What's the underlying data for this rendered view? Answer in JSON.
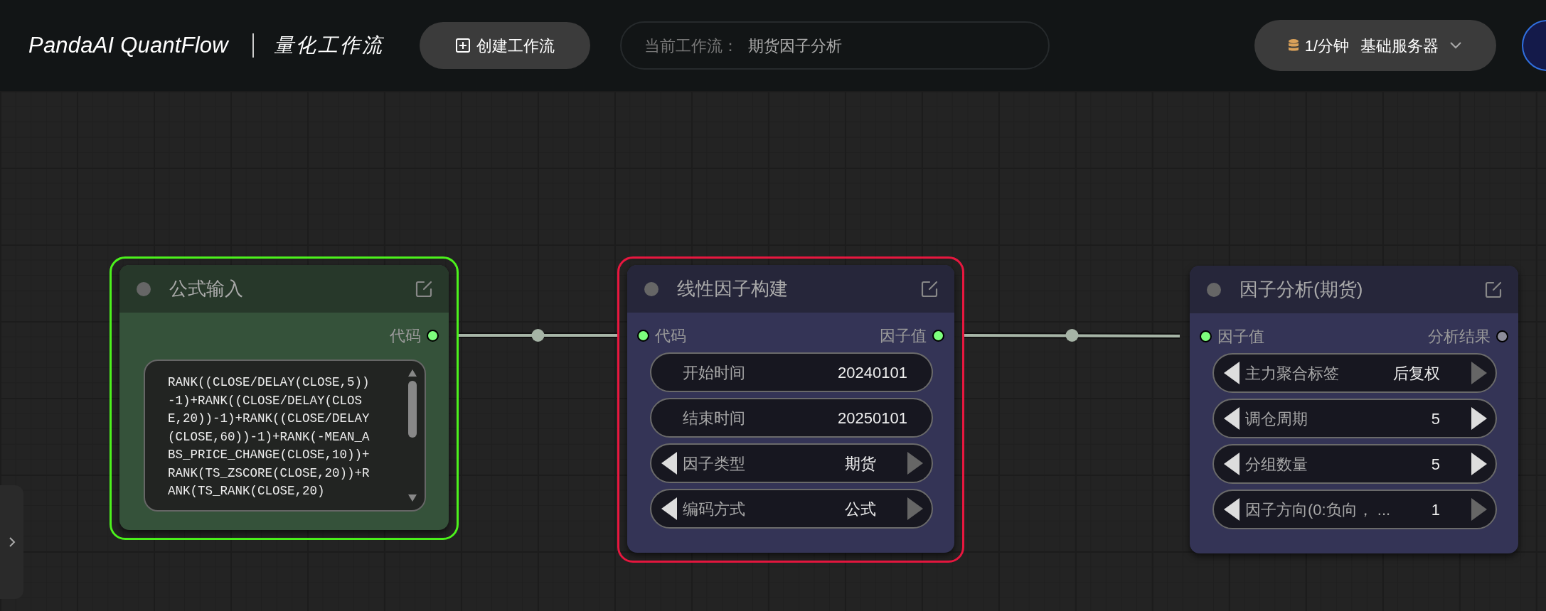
{
  "header": {
    "logo": "PandaAI QuantFlow",
    "title": "量化工作流",
    "create_button": "创建工作流",
    "current_workflow": {
      "label": "当前工作流：",
      "value": "期货因子分析"
    },
    "server": {
      "rate": "1/分钟",
      "name": "基础服务器"
    }
  },
  "nodes": [
    {
      "title": "公式输入",
      "color": "#35523a",
      "selected": true,
      "error": false,
      "outputs": [
        {
          "label": "代码",
          "connected": true
        }
      ],
      "widgets": [
        {
          "kind": "code",
          "value": "RANK((CLOSE/DELAY(CLOSE,5))-1)+RANK((CLOSE/DELAY(CLOSE,20))-1)+RANK((CLOSE/DELAY(CLOSE,60))-1)+RANK(-MEAN_ABS_PRICE_CHANGE(CLOSE,10))+RANK(TS_ZSCORE(CLOSE,20))+RANK(TS_RANK(CLOSE,20)"
        }
      ]
    },
    {
      "title": "线性因子构建",
      "color": "#343456",
      "selected": false,
      "error": true,
      "inputs": [
        {
          "label": "代码",
          "connected": true
        }
      ],
      "outputs": [
        {
          "label": "因子值",
          "connected": true
        }
      ],
      "widgets": [
        {
          "kind": "text",
          "label": "开始时间",
          "value": "20240101"
        },
        {
          "kind": "text",
          "label": "结束时间",
          "value": "20250101"
        },
        {
          "kind": "combo",
          "label": "因子类型",
          "value": "期货",
          "prev_enabled": true,
          "next_enabled": false
        },
        {
          "kind": "combo",
          "label": "编码方式",
          "value": "公式",
          "prev_enabled": true,
          "next_enabled": false
        }
      ]
    },
    {
      "title": "因子分析(期货)",
      "color": "#343456",
      "selected": false,
      "error": false,
      "inputs": [
        {
          "label": "因子值",
          "connected": true
        }
      ],
      "outputs": [
        {
          "label": "分析结果",
          "connected": false
        }
      ],
      "widgets": [
        {
          "kind": "combo",
          "label": "主力聚合标签",
          "value": "后复权",
          "prev_enabled": true,
          "next_enabled": false
        },
        {
          "kind": "combo",
          "label": "调仓周期",
          "value": "5",
          "prev_enabled": true,
          "next_enabled": true
        },
        {
          "kind": "combo",
          "label": "分组数量",
          "value": "5",
          "prev_enabled": true,
          "next_enabled": true
        },
        {
          "kind": "combo",
          "label": "因子方向(0:负向，  ...",
          "value": "1",
          "prev_enabled": true,
          "next_enabled": false
        }
      ]
    }
  ]
}
